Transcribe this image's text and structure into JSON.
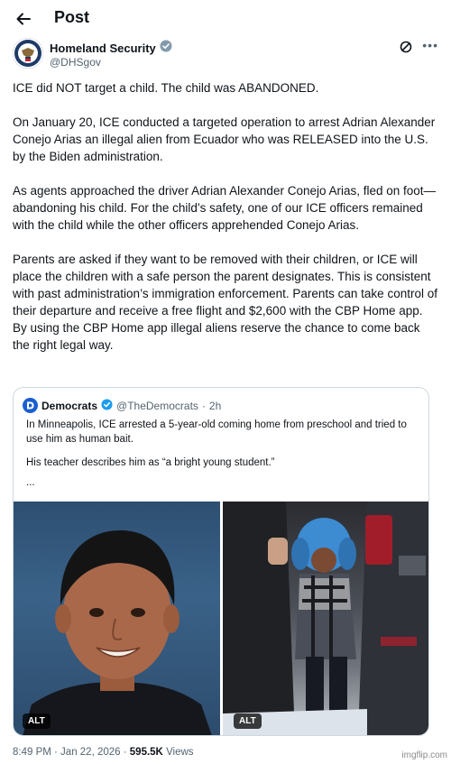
{
  "header": {
    "title": "Post",
    "back_icon": "back-arrow-icon"
  },
  "author": {
    "name": "Homeland Security",
    "handle": "@DHSgov",
    "verified_color": "#829aab",
    "avatar_icon": "dhs-seal-icon"
  },
  "post": {
    "paragraphs": [
      "ICE did NOT target a child. The child was ABANDONED.",
      "On January 20, ICE conducted a targeted operation to arrest Adrian Alexander Conejo Arias an illegal alien from Ecuador who was RELEASED into the U.S. by the Biden administration.",
      "As agents approached the driver Adrian Alexander Conejo Arias, fled on foot—abandoning his child. For the child’s safety, one of our ICE officers remained with the child while the other officers apprehended Conejo Arias.",
      "Parents are asked if they want to be removed with their children, or ICE will place the children with a safe person the parent designates. This is consistent with past administration’s immigration enforcement. Parents can take control of their departure and receive a free flight and $2,600 with the CBP Home app. By using the CBP Home app illegal aliens reserve the chance to come back the right legal way."
    ]
  },
  "quote": {
    "name": "Democrats",
    "handle": "@TheDemocrats",
    "separator": "·",
    "time": "2h",
    "verified_color": "#1d9bf0",
    "line1": "In Minneapolis, ICE arrested a 5-year-old coming home from preschool and tried to use him as human bait.",
    "line2": "His teacher describes him as “a bright young student.”",
    "ellipsis": "...",
    "media": [
      {
        "alt_label": "ALT"
      },
      {
        "alt_label": "ALT"
      }
    ]
  },
  "meta": {
    "time": "8:49 PM · Jan 22, 2026 · ",
    "views_count": "595.5K",
    "views_label": " Views"
  },
  "watermark": "imgflip.com"
}
